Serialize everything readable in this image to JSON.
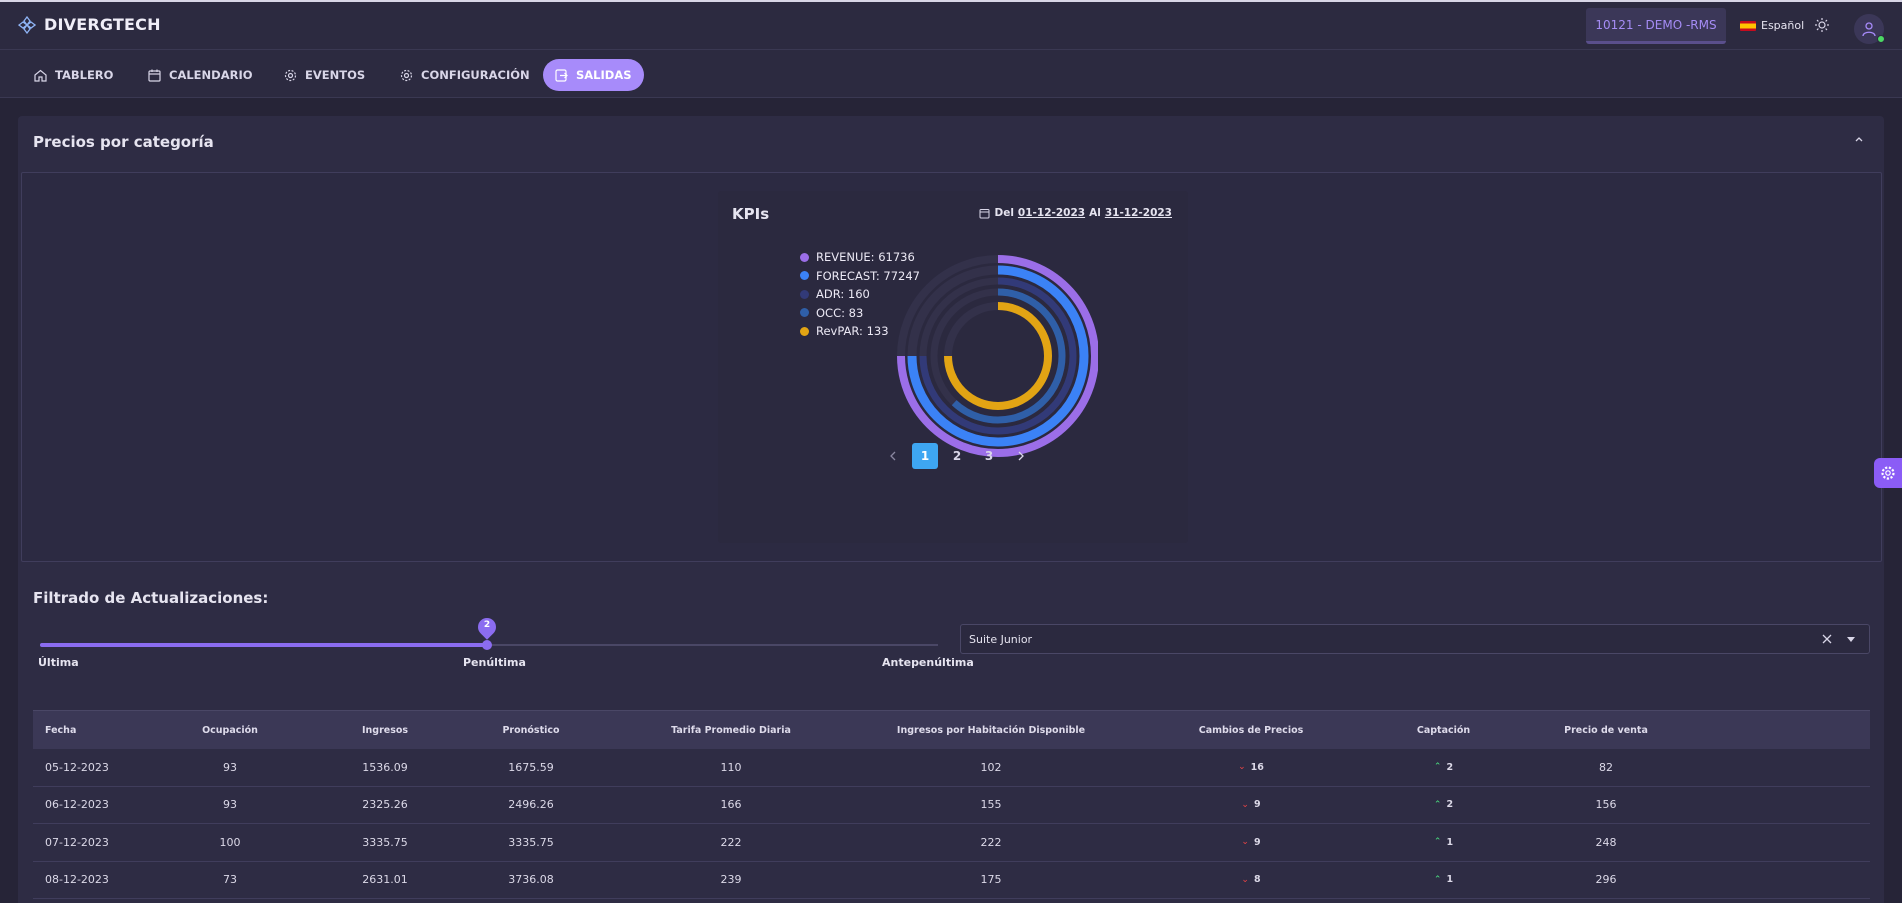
{
  "app": {
    "brand": "DIVERGTECH"
  },
  "header": {
    "property_badge": "10121 - DEMO -RMS",
    "language": "Español",
    "colors": {
      "accent": "#a78bfa",
      "badge_text": "#a58cf5"
    }
  },
  "nav": {
    "items": [
      {
        "label": "TABLERO",
        "icon": "home-icon"
      },
      {
        "label": "CALENDARIO",
        "icon": "calendar-icon"
      },
      {
        "label": "EVENTOS",
        "icon": "gear-icon"
      },
      {
        "label": "CONFIGURACIÓN",
        "icon": "gear-icon"
      },
      {
        "label": "SALIDAS",
        "icon": "export-icon",
        "active": true
      }
    ]
  },
  "section": {
    "title": "Precios por categoría"
  },
  "kpi": {
    "title": "KPIs",
    "date_prefix": "Del",
    "date_from": "01-12-2023",
    "date_mid": "Al",
    "date_to": "31-12-2023",
    "pages": [
      "1",
      "2",
      "3"
    ],
    "current_page": "1"
  },
  "chart_data": {
    "type": "radialBar",
    "title": "KPIs",
    "series": [
      {
        "name": "REVENUE",
        "value": 61736,
        "label": "REVENUE: 61736",
        "color": "#9b6ee8",
        "fraction": 0.75
      },
      {
        "name": "FORECAST",
        "value": 77247,
        "label": "FORECAST: 77247",
        "color": "#3b82f6",
        "fraction": 0.75
      },
      {
        "name": "ADR",
        "value": 160,
        "label": "ADR: 160",
        "color": "#323a78",
        "fraction": 0.75
      },
      {
        "name": "OCC",
        "value": 83,
        "label": "OCC: 83",
        "color": "#2f5fa8",
        "fraction": 0.62
      },
      {
        "name": "RevPAR",
        "value": 133,
        "label": "RevPAR: 133",
        "color": "#e2a414",
        "fraction": 0.75
      }
    ]
  },
  "filter": {
    "title": "Filtrado de Actualizaciones:",
    "slider_labels": [
      "Última",
      "Penúltima",
      "Antepenúltima"
    ],
    "slider_value": "2",
    "room_type": "Suite Junior"
  },
  "table": {
    "columns": [
      "Fecha",
      "Ocupación",
      "Ingresos",
      "Pronóstico",
      "Tarifa Promedio Diaria",
      "Ingresos por Habitación Disponible",
      "Cambios de Precios",
      "Captación",
      "Precio de venta"
    ],
    "rows": [
      [
        "05-12-2023",
        "93",
        "1536.09",
        "1675.59",
        "110",
        "102",
        "16",
        "2",
        "82"
      ],
      [
        "06-12-2023",
        "93",
        "2325.26",
        "2496.26",
        "166",
        "155",
        "9",
        "2",
        "156"
      ],
      [
        "07-12-2023",
        "100",
        "3335.75",
        "3335.75",
        "222",
        "222",
        "9",
        "1",
        "248"
      ],
      [
        "08-12-2023",
        "73",
        "2631.01",
        "3736.08",
        "239",
        "175",
        "8",
        "1",
        "296"
      ]
    ]
  }
}
